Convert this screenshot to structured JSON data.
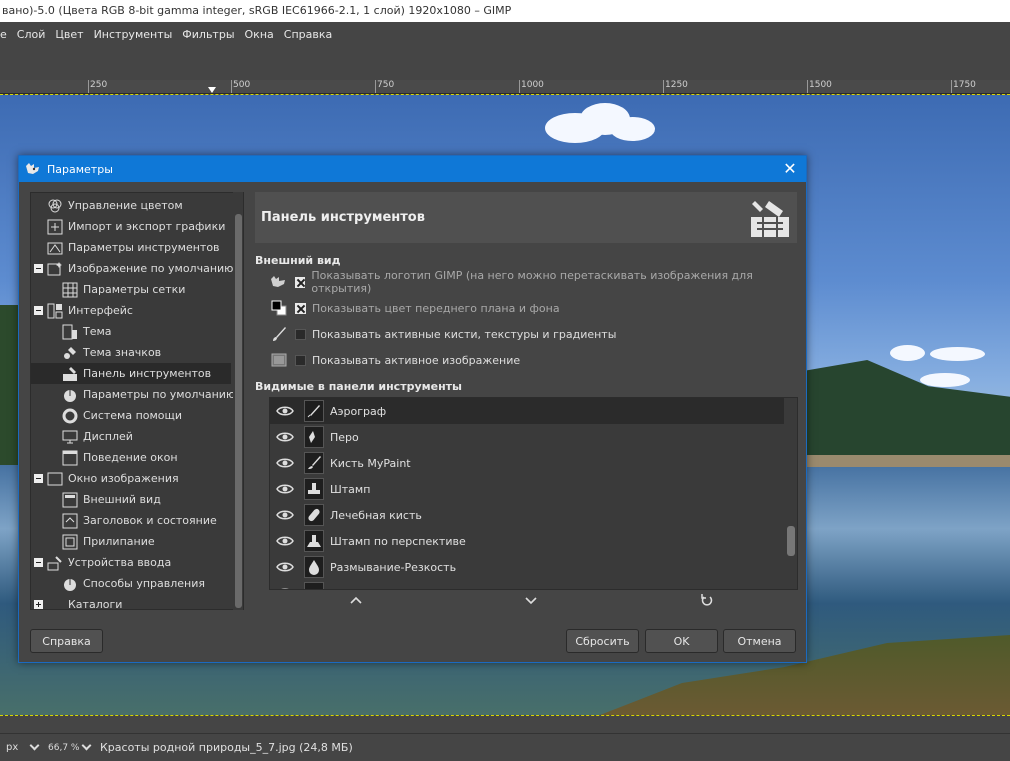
{
  "app": {
    "window_title": "вано)-5.0 (Цвета RGB 8-bit gamma integer, sRGB IEC61966-2.1, 1 слой) 1920x1080 – GIMP",
    "menu": [
      "е",
      "Слой",
      "Цвет",
      "Инструменты",
      "Фильтры",
      "Окна",
      "Справка"
    ],
    "ruler_labels": [
      "250",
      "500",
      "750",
      "1000",
      "1250",
      "1500",
      "1750"
    ]
  },
  "status": {
    "unit": "px",
    "zoom": "66,7 %",
    "file": "Красоты родной природы_5_7.jpg (24,8 МБ)"
  },
  "dialog": {
    "title": "Параметры",
    "close": "✕",
    "tree": [
      {
        "label": "Управление цветом",
        "icon": "color-management-icon"
      },
      {
        "label": "Импорт и экспорт графики",
        "icon": "import-export-icon"
      },
      {
        "label": "Параметры инструментов",
        "icon": "tool-options-icon"
      },
      {
        "label": "Изображение по умолчанию",
        "icon": "default-image-icon"
      },
      {
        "label": "Параметры сетки",
        "icon": "grid-icon"
      },
      {
        "label": "Интерфейс",
        "icon": "interface-icon"
      },
      {
        "label": "Тема",
        "icon": "theme-icon"
      },
      {
        "label": "Тема значков",
        "icon": "icon-theme-icon"
      },
      {
        "label": "Панель инструментов",
        "icon": "toolbox-icon"
      },
      {
        "label": "Параметры по умолчанию",
        "icon": "default-params-icon"
      },
      {
        "label": "Система помощи",
        "icon": "help-system-icon"
      },
      {
        "label": "Дисплей",
        "icon": "display-icon"
      },
      {
        "label": "Поведение окон",
        "icon": "window-behavior-icon"
      },
      {
        "label": "Окно изображения",
        "icon": "image-window-icon"
      },
      {
        "label": "Внешний вид",
        "icon": "appearance-icon"
      },
      {
        "label": "Заголовок и состояние",
        "icon": "title-status-icon"
      },
      {
        "label": "Прилипание",
        "icon": "snapping-icon"
      },
      {
        "label": "Устройства ввода",
        "icon": "input-devices-icon"
      },
      {
        "label": "Способы управления",
        "icon": "input-controllers-icon"
      },
      {
        "label": "Каталоги",
        "icon": "folders-icon"
      }
    ],
    "panel_title": "Панель инструментов",
    "appearance_heading": "Внешний вид",
    "options": [
      {
        "label": "Показывать логотип GIMP (на него можно перетаскивать изображения для открытия)",
        "checked": true
      },
      {
        "label": "Показывать цвет переднего плана и фона",
        "checked": true
      },
      {
        "label": "Показывать активные кисти, текстуры и градиенты",
        "checked": false
      },
      {
        "label": "Показывать активное изображение",
        "checked": false
      }
    ],
    "visible_heading": "Видимые в панели инструменты",
    "tools": [
      "Аэрограф",
      "Перо",
      "Кисть MyPaint",
      "Штамп",
      "Лечебная кисть",
      "Штамп по перспективе",
      "Размывание-Резкость"
    ],
    "buttons": {
      "help": "Справка",
      "reset": "Сбросить",
      "ok": "OK",
      "cancel": "Отмена"
    }
  }
}
